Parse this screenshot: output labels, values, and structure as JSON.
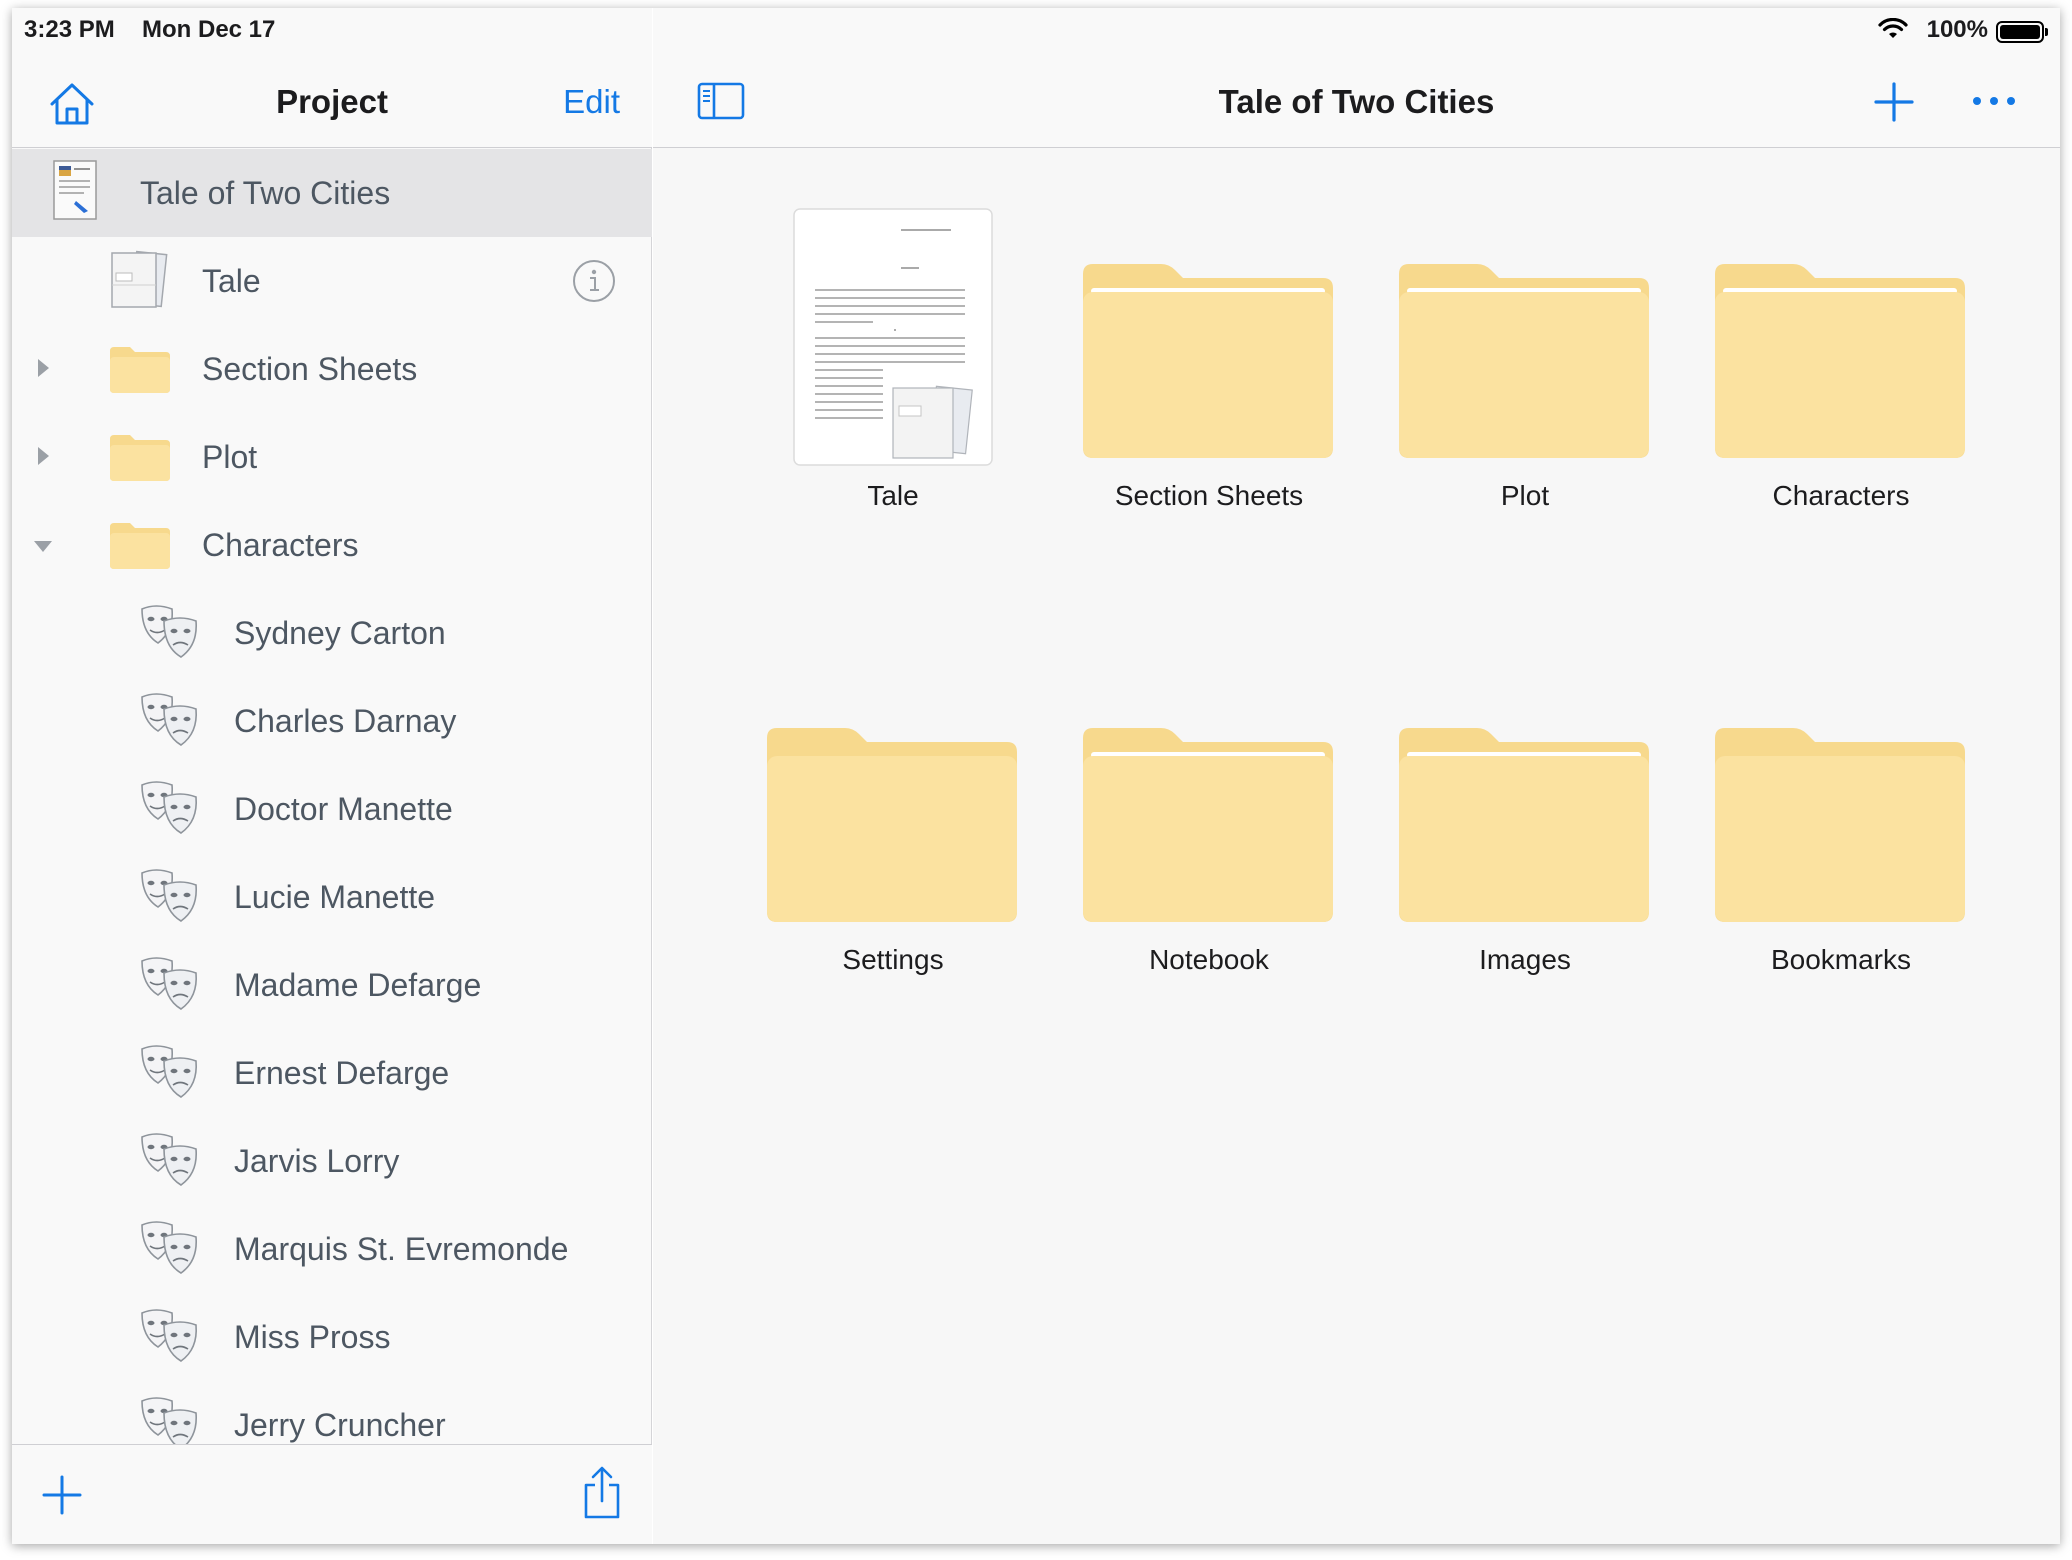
{
  "status_bar": {
    "time": "3:23 PM",
    "date": "Mon Dec 17",
    "battery": "100%",
    "battery_level": 1.0
  },
  "sidebar": {
    "title": "Project",
    "edit_label": "Edit",
    "home_icon": "home-icon",
    "items": [
      {
        "label": "Tale of Two Cities",
        "type": "project",
        "icon": "project-document-icon",
        "selected": true
      },
      {
        "label": "Tale",
        "type": "manuscript",
        "icon": "manuscript-icon",
        "info": true
      },
      {
        "label": "Section Sheets",
        "type": "folder",
        "icon": "folder-icon",
        "disclosure": "collapsed"
      },
      {
        "label": "Plot",
        "type": "folder",
        "icon": "folder-icon",
        "disclosure": "collapsed"
      },
      {
        "label": "Characters",
        "type": "folder",
        "icon": "folder-icon",
        "disclosure": "expanded"
      },
      {
        "label": "Sydney Carton",
        "type": "character",
        "icon": "theater-masks-icon"
      },
      {
        "label": "Charles Darnay",
        "type": "character",
        "icon": "theater-masks-icon"
      },
      {
        "label": "Doctor Manette",
        "type": "character",
        "icon": "theater-masks-icon"
      },
      {
        "label": "Lucie Manette",
        "type": "character",
        "icon": "theater-masks-icon"
      },
      {
        "label": "Madame Defarge",
        "type": "character",
        "icon": "theater-masks-icon"
      },
      {
        "label": "Ernest Defarge",
        "type": "character",
        "icon": "theater-masks-icon"
      },
      {
        "label": "Jarvis Lorry",
        "type": "character",
        "icon": "theater-masks-icon"
      },
      {
        "label": "Marquis St. Evremonde",
        "type": "character",
        "icon": "theater-masks-icon"
      },
      {
        "label": "Miss Pross",
        "type": "character",
        "icon": "theater-masks-icon"
      },
      {
        "label": "Jerry Cruncher",
        "type": "character",
        "icon": "theater-masks-icon"
      }
    ],
    "toolbar": {
      "add_icon": "plus-icon",
      "share_icon": "share-icon"
    }
  },
  "main": {
    "title": "Tale of Two Cities",
    "toolbar": {
      "sidebar_icon": "sidebar-toggle-icon",
      "add_icon": "plus-icon",
      "more_icon": "more-icon"
    },
    "grid": [
      {
        "label": "Tale",
        "type": "document",
        "icon": "document-thumbnail"
      },
      {
        "label": "Section Sheets",
        "type": "folder",
        "icon": "folder-icon"
      },
      {
        "label": "Plot",
        "type": "folder",
        "icon": "folder-icon"
      },
      {
        "label": "Characters",
        "type": "folder",
        "icon": "folder-icon"
      },
      {
        "label": "Settings",
        "type": "folder",
        "icon": "folder-icon"
      },
      {
        "label": "Notebook",
        "type": "folder",
        "icon": "folder-icon"
      },
      {
        "label": "Images",
        "type": "folder",
        "icon": "folder-icon"
      },
      {
        "label": "Bookmarks",
        "type": "folder",
        "icon": "folder-icon"
      }
    ]
  },
  "colors": {
    "accent": "#1479e5",
    "folder": "#fbe2a0",
    "folder_tab": "#f7d98d",
    "selection": "#e4e4e6",
    "sidebar_text": "#4d5762"
  }
}
